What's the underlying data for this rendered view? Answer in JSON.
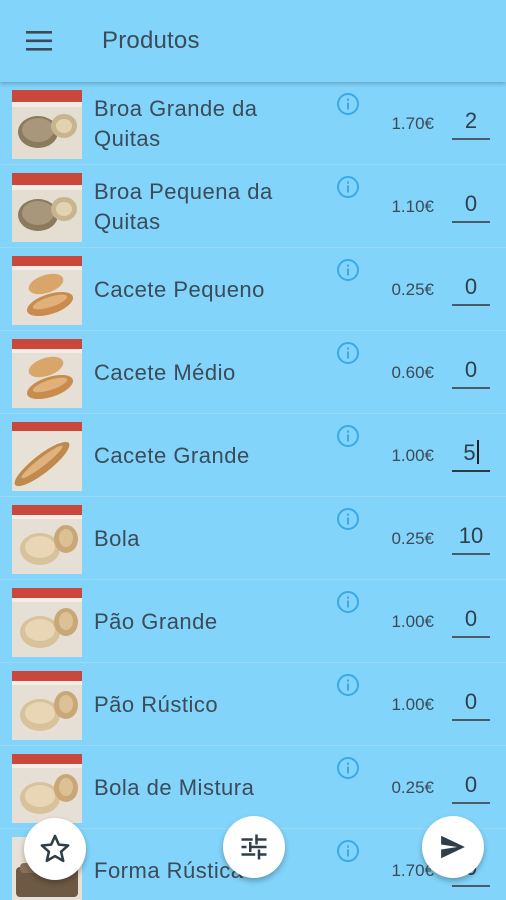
{
  "appbar": {
    "title": "Produtos",
    "menu_icon": "menu-icon"
  },
  "colors": {
    "background": "#82d4fb",
    "info_icon": "#3aa9e8",
    "text": "#3b4b57"
  },
  "products": [
    {
      "name": "Broa Grande da Quitas",
      "price": "1.70€",
      "quantity": "2",
      "image": "broa-bread-image"
    },
    {
      "name": "Broa Pequena da Quitas",
      "price": "1.10€",
      "quantity": "0",
      "image": "broa-bread-image"
    },
    {
      "name": "Cacete Pequeno",
      "price": "0.25€",
      "quantity": "0",
      "image": "cacete-bread-image"
    },
    {
      "name": "Cacete Médio",
      "price": "0.60€",
      "quantity": "0",
      "image": "cacete-bread-image"
    },
    {
      "name": "Cacete Grande",
      "price": "1.00€",
      "quantity": "5",
      "image": "baguette-bread-image"
    },
    {
      "name": "Bola",
      "price": "0.25€",
      "quantity": "10",
      "image": "round-bread-image"
    },
    {
      "name": "Pão Grande",
      "price": "1.00€",
      "quantity": "0",
      "image": "round-bread-image"
    },
    {
      "name": "Pão Rústico",
      "price": "1.00€",
      "quantity": "0",
      "image": "round-bread-image"
    },
    {
      "name": "Bola de Mistura",
      "price": "0.25€",
      "quantity": "0",
      "image": "round-bread-image"
    },
    {
      "name": "Forma Rústica",
      "price": "1.70€",
      "quantity": "0",
      "image": "loaf-bread-image"
    }
  ],
  "fabs": {
    "favorites_icon": "star-icon",
    "filter_icon": "tune-icon",
    "send_icon": "send-icon"
  }
}
